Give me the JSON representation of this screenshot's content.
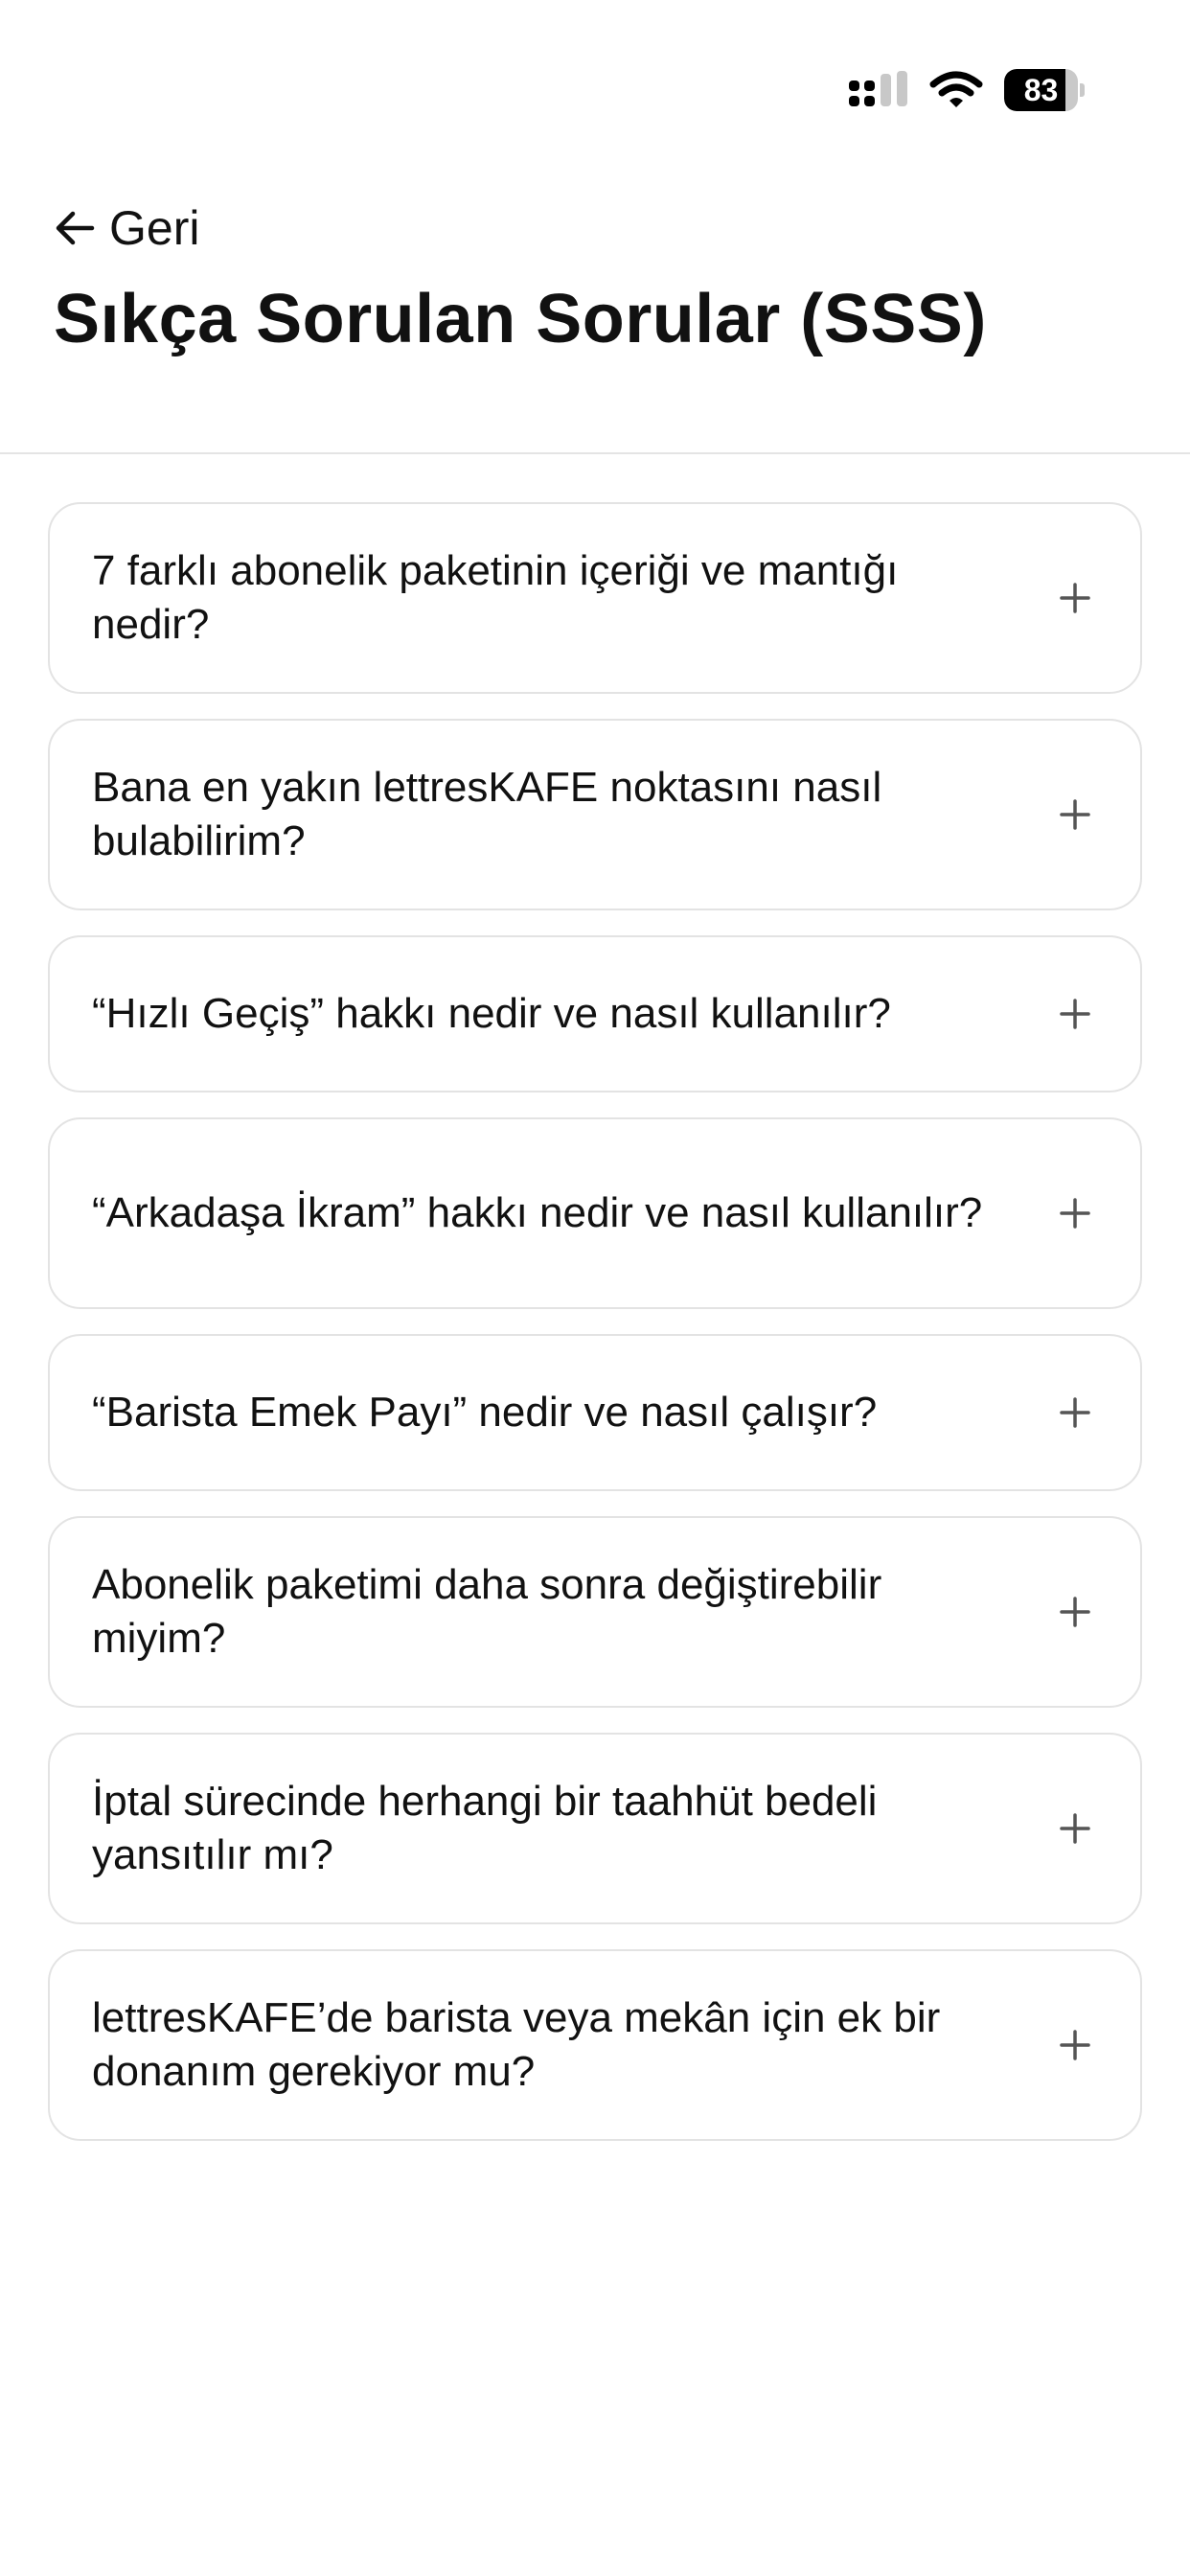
{
  "status_bar": {
    "battery_level": "83",
    "battery_fraction": 0.83,
    "icons": [
      "cellular-signal-icon",
      "wifi-icon",
      "battery-icon"
    ]
  },
  "header": {
    "back_label": "Geri",
    "back_icon": "arrow-left-icon",
    "title": "Sıkça Sorulan Sorular (SSS)"
  },
  "faq": {
    "expand_icon": "plus-icon",
    "items": [
      {
        "question": "7 farklı abonelik paketinin içeriği ve mantığı nedir?"
      },
      {
        "question": "Bana en yakın lettresKAFE noktasını nasıl bulabilirim?"
      },
      {
        "question": "“Hızlı Geçiş” hakkı nedir ve nasıl kullanılır?"
      },
      {
        "question": "“Arkadaşa İkram” hakkı nedir ve nasıl kullanılır?"
      },
      {
        "question": "“Barista Emek Payı” nedir ve nasıl çalışır?"
      },
      {
        "question": "Abonelik paketimi daha sonra değiştirebilir miyim?"
      },
      {
        "question": "İptal sürecinde herhangi bir taahhüt bedeli yansıtılır mı?"
      },
      {
        "question": "lettresKAFE’de barista veya mekân için ek bir donanım gerekiyor mu?"
      }
    ]
  },
  "colors": {
    "text": "#111111",
    "border": "#e3e3e3",
    "icon": "#555555",
    "background": "#ffffff"
  }
}
